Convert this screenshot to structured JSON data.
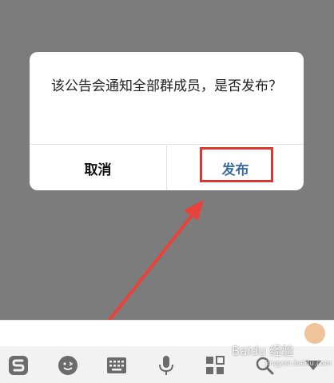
{
  "dialog": {
    "message": "该公告会通知全部群成员，是否发布？",
    "cancel_label": "取消",
    "publish_label": "发布"
  },
  "keyboard_toolbar": {
    "icons": [
      "sogou-logo-icon",
      "emoji-icon",
      "keyboard-icon",
      "microphone-icon",
      "grid-apps-icon",
      "search-icon",
      "collapse-triangle-icon"
    ]
  },
  "watermark": {
    "text": "Baidu 经验",
    "subtext": "jingyan.baidu.com"
  },
  "colors": {
    "backdrop": "#7c7c7c",
    "publish_text": "#3e6da3",
    "highlight": "#d9392f"
  }
}
